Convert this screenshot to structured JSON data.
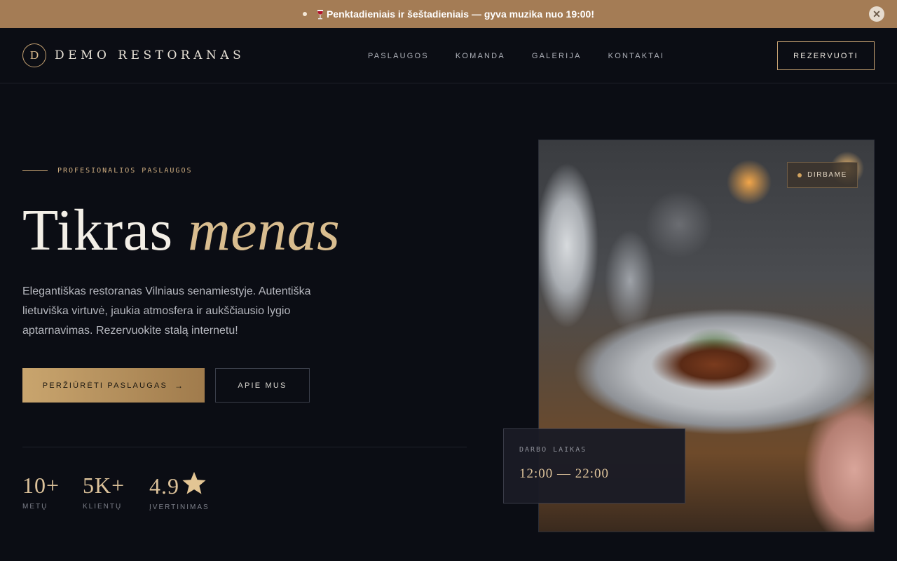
{
  "announcement": {
    "text": "Penktadieniais ir šeštadieniais — gyva muzika nuo 19:00!",
    "close_label": "✕"
  },
  "header": {
    "logo_letter": "D",
    "logo_text": "DEMO RESTORANAS",
    "nav": [
      "PASLAUGOS",
      "KOMANDA",
      "GALERIJA",
      "KONTAKTAI"
    ],
    "reserve_label": "REZERVUOTI"
  },
  "hero": {
    "eyebrow": "PROFESIONALIOS PASLAUGOS",
    "title_plain": "Tikras",
    "title_accent": "menas",
    "description": "Elegantiškas restoranas Vilniaus senamiestyje. Autentiška lietuviška virtuvė, jaukia atmosfera ir aukščiausio lygio aptarnavimas. Rezervuokite stalą internetu!",
    "primary_button": "PERŽIŪRĖTI PASLAUGAS",
    "primary_arrow": "→",
    "secondary_button": "APIE MUS"
  },
  "stats": [
    {
      "value": "10+",
      "label": "METŲ"
    },
    {
      "value": "5K+",
      "label": "KLIENTŲ"
    },
    {
      "value": "4.9",
      "label": "ĮVERTINIMAS"
    }
  ],
  "photo": {
    "badge": "DIRBAME",
    "hours_label": "DARBO LAIKAS",
    "hours_value": "12:00 — 22:00"
  },
  "colors": {
    "accent": "#c6a272",
    "announcement_bg": "#a47c55",
    "background": "#0b0d14"
  },
  "icons": [
    "wine-glass-icon",
    "close-icon",
    "arrow-right-icon",
    "star-icon"
  ]
}
